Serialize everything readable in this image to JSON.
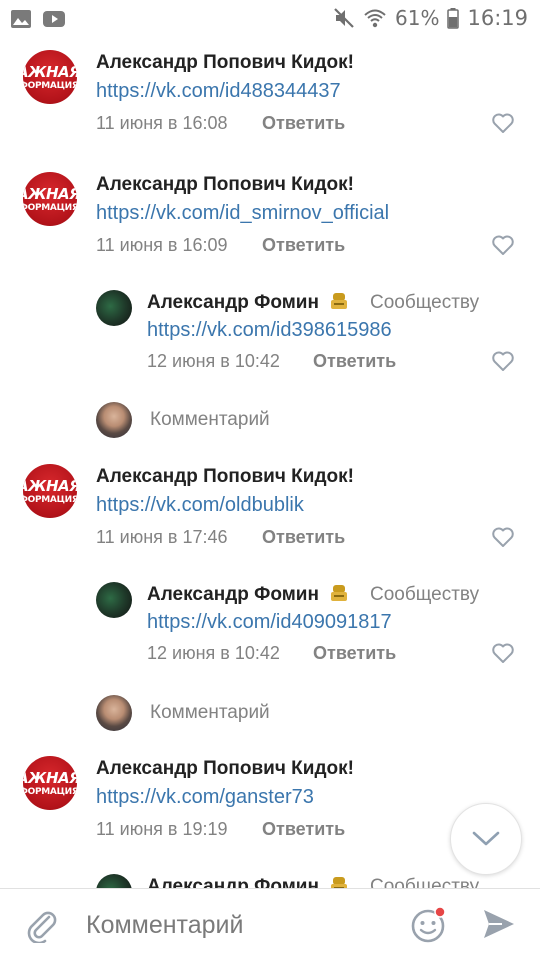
{
  "status_bar": {
    "battery": "61%",
    "time": "16:19"
  },
  "colors": {
    "link": "#3b76ad",
    "meta": "#828282",
    "accent_red": "#c8161e"
  },
  "comments": [
    {
      "author": "Александр Попович Кидок!",
      "link": "https://vk.com/id488344437",
      "date": "11 июня в 16:08",
      "reply": "Ответить",
      "avatar_text": [
        "АЖНАЯ",
        "ФОРМАЦИЯ"
      ]
    },
    {
      "author": "Александр Попович Кидок!",
      "link": "https://vk.com/id_smirnov_official",
      "date": "11 июня в 16:09",
      "reply": "Ответить",
      "avatar_text": [
        "АЖНАЯ",
        "ФОРМАЦИЯ"
      ],
      "reply_item": {
        "author": "Александр Фомин",
        "community": "Сообществу",
        "link": "https://vk.com/id398615986",
        "date": "12 июня в 10:42",
        "reply": "Ответить"
      },
      "reply_placeholder": "Комментарий"
    },
    {
      "author": "Александр Попович Кидок!",
      "link": "https://vk.com/oldbublik",
      "date": "11 июня в 17:46",
      "reply": "Ответить",
      "avatar_text": [
        "АЖНАЯ",
        "ФОРМАЦИЯ"
      ],
      "reply_item": {
        "author": "Александр Фомин",
        "community": "Сообществу",
        "link": "https://vk.com/id409091817",
        "date": "12 июня в 10:42",
        "reply": "Ответить"
      },
      "reply_placeholder": "Комментарий"
    },
    {
      "author": "Александр Попович Кидок!",
      "link": "https://vk.com/ganster73",
      "date": "11 июня в 19:19",
      "reply": "Ответить",
      "avatar_text": [
        "АЖНАЯ",
        "ФОРМАЦИЯ"
      ],
      "reply_item": {
        "author": "Александр Фомин",
        "community": "Сообществу"
      }
    }
  ],
  "input_bar": {
    "placeholder": "Комментарий"
  },
  "icons": {
    "gallery": "gallery-icon",
    "youtube": "youtube-icon",
    "mute": "mute-icon",
    "wifi": "wifi-icon",
    "battery": "battery-icon",
    "like": "heart-icon",
    "scroll_down": "chevron-down-icon",
    "attach": "paperclip-icon",
    "emoji": "emoji-icon",
    "send": "send-icon"
  }
}
